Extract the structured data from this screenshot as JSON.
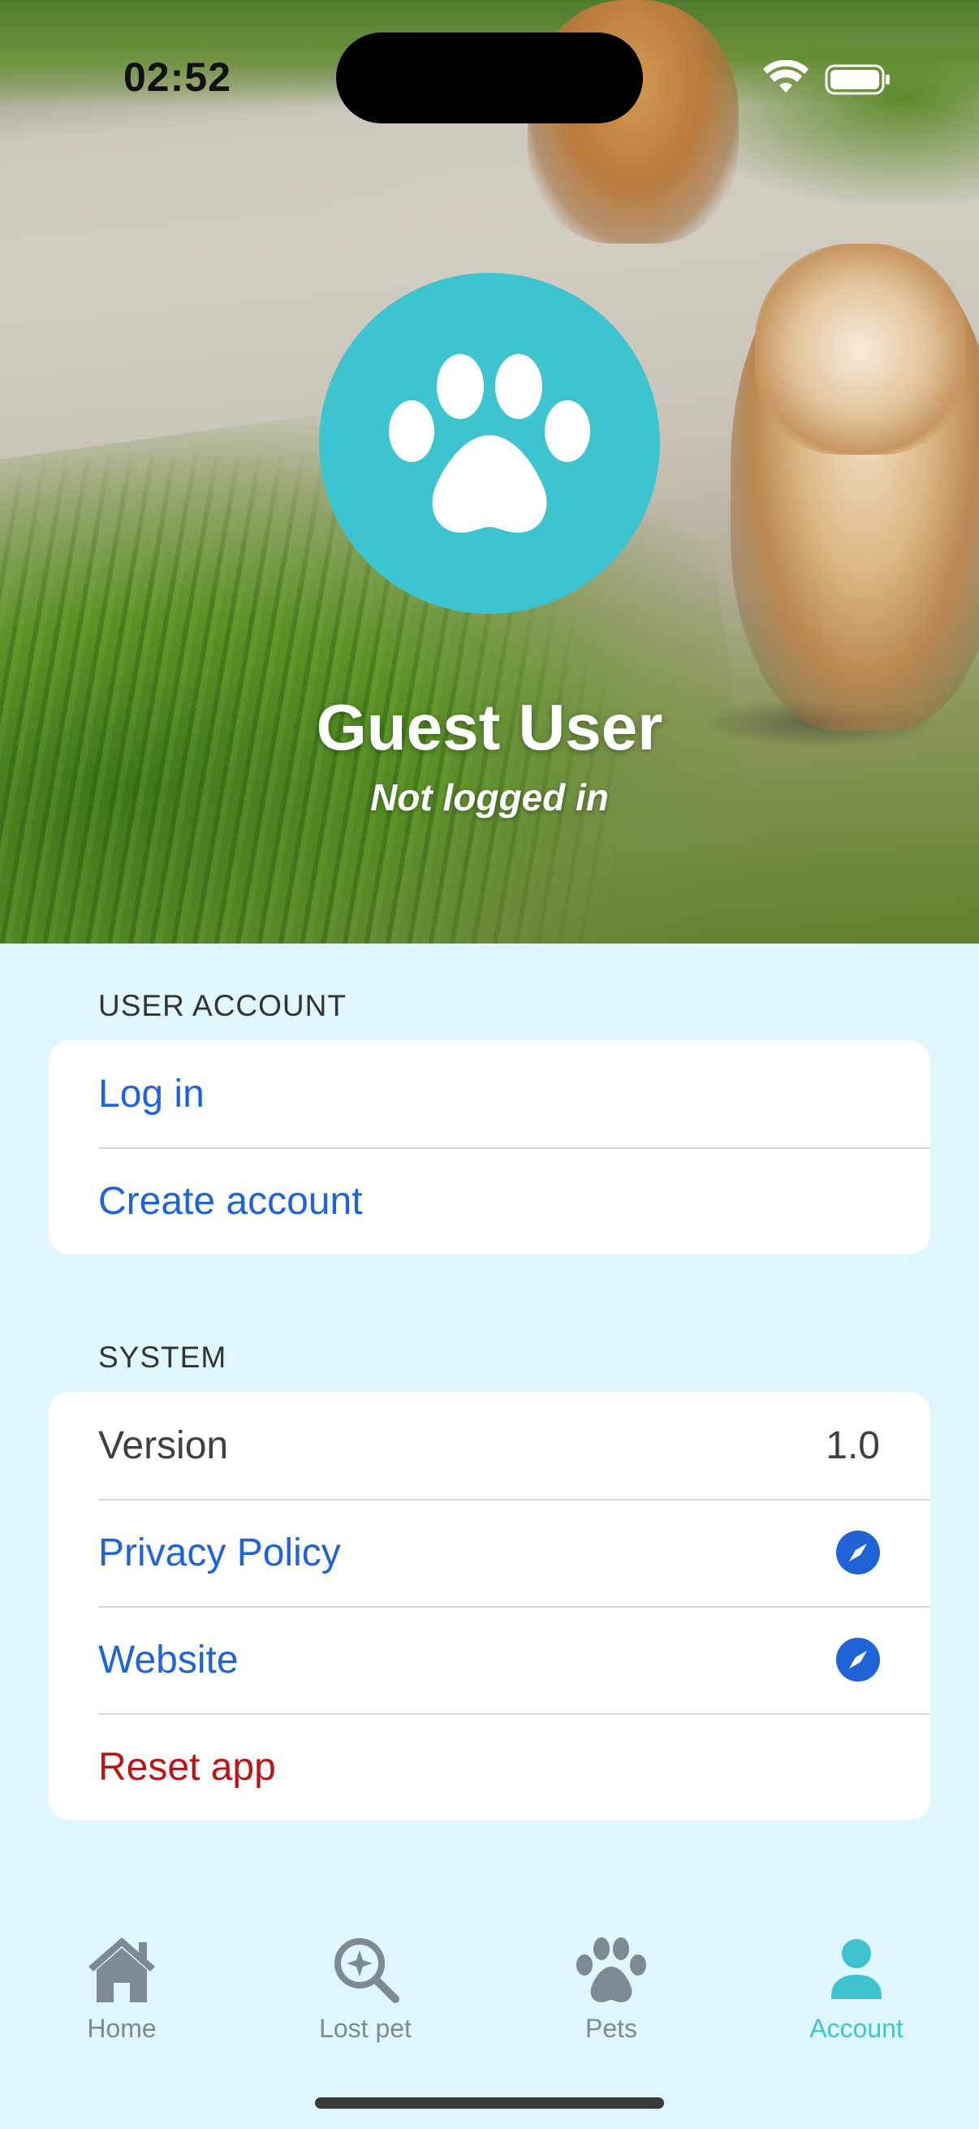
{
  "status_bar": {
    "time": "02:52"
  },
  "profile": {
    "name": "Guest User",
    "status": "Not logged in",
    "avatar_icon": "paw-icon",
    "avatar_color": "#3dc4cf"
  },
  "sections": {
    "user_account": {
      "header": "USER ACCOUNT",
      "items": [
        {
          "label": "Log in"
        },
        {
          "label": "Create account"
        }
      ]
    },
    "system": {
      "header": "SYSTEM",
      "version_label": "Version",
      "version_value": "1.0",
      "privacy_label": "Privacy Policy",
      "website_label": "Website",
      "reset_label": "Reset app"
    }
  },
  "tab_bar": {
    "active": "Account",
    "items": [
      {
        "label": "Home",
        "icon": "house-icon"
      },
      {
        "label": "Lost pet",
        "icon": "search-sparkle-icon"
      },
      {
        "label": "Pets",
        "icon": "paw-icon"
      },
      {
        "label": "Account",
        "icon": "person-icon"
      }
    ]
  },
  "colors": {
    "accent": "#3ec3cf",
    "link": "#1f63d6",
    "destructive": "#bd1515",
    "background": "#dff6fc",
    "tab_inactive": "#7d8a96"
  }
}
